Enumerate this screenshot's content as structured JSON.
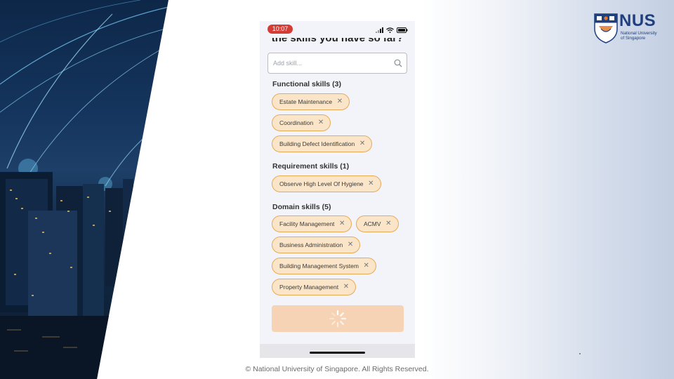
{
  "slide": {
    "copyright": "©  National University of Singapore. All Rights Reserved."
  },
  "logo": {
    "name": "NUS",
    "subtitle_line1": "National University",
    "subtitle_line2": "of Singapore"
  },
  "phone": {
    "status_time": "10:07",
    "heading_partial": "the skills you have so far?",
    "search": {
      "placeholder": "Add skill..."
    },
    "sections": [
      {
        "title": "Functional skills (3)",
        "chips": [
          "Estate Maintenance",
          "Coordination",
          "Building Defect Identification"
        ]
      },
      {
        "title": "Requirement skills (1)",
        "chips": [
          "Observe High Level Of Hygiene"
        ]
      },
      {
        "title": "Domain skills (5)",
        "chips": [
          "Facility Management",
          "ACMV",
          "Business Administration",
          "Building Management System",
          "Property Management"
        ]
      }
    ],
    "chip_remove_glyph": "✕",
    "submit_state": "loading"
  },
  "colors": {
    "chip_bg": "#fbe5c9",
    "chip_border": "#e8a955",
    "button_bg": "#f6d3b4",
    "time_pill": "#d63c36",
    "brand_blue": "#1f3f7f"
  }
}
